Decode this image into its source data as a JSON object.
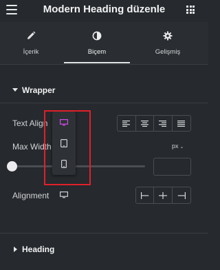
{
  "header": {
    "title": "Modern Heading düzenle",
    "menu_icon": "hamburger-icon",
    "apps_icon": "grid-icon"
  },
  "tabs": [
    {
      "label": "İçerik",
      "icon": "pencil-icon",
      "active": false
    },
    {
      "label": "Biçem",
      "icon": "contrast-icon",
      "active": true
    },
    {
      "label": "Gelişmiş",
      "icon": "gear-icon",
      "active": false
    }
  ],
  "sections": {
    "wrapper": {
      "title": "Wrapper",
      "expanded": true
    },
    "heading": {
      "title": "Heading",
      "expanded": false
    }
  },
  "controls": {
    "text_align": {
      "label": "Text Align",
      "options": [
        "align-left-icon",
        "align-center-icon",
        "align-right-icon",
        "align-justify-icon"
      ]
    },
    "max_width": {
      "label": "Max Width",
      "unit": "px",
      "value": "",
      "slider_value": 0
    },
    "alignment": {
      "label": "Alignment",
      "options": [
        "align-start-icon",
        "align-middle-icon",
        "align-end-icon"
      ]
    }
  },
  "device_switcher": {
    "options": [
      "desktop",
      "tablet",
      "mobile"
    ],
    "selected": "desktop",
    "accent_color": "#d04ee8",
    "highlight_color": "#e0202a"
  }
}
